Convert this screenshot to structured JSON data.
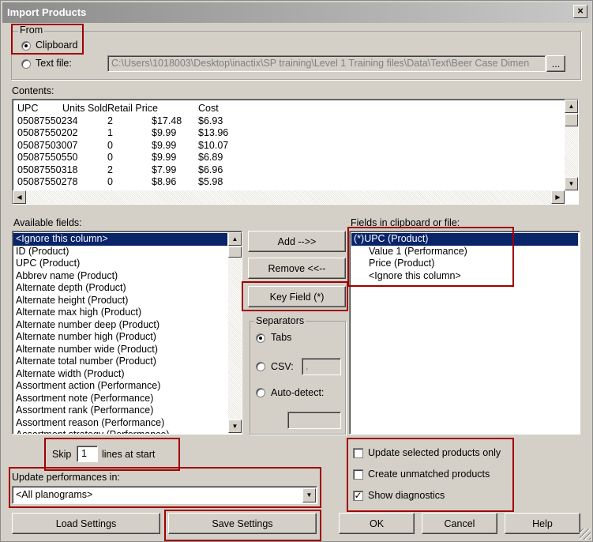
{
  "window": {
    "title": "Import Products",
    "close": "×"
  },
  "from": {
    "legend": "From",
    "clipboard_label": "Clipboard",
    "textfile_label": "Text file:",
    "textfile_path": "C:\\Users\\1018003\\Desktop\\inactix\\SP training\\Level 1 Training files\\Data\\Text\\Beer Case Dimen",
    "browse_label": "...",
    "selected": "clipboard"
  },
  "contents": {
    "label": "Contents:",
    "headers": [
      "UPC",
      "Units Sold",
      "Retail Price",
      "Cost"
    ],
    "rows": [
      [
        "05087550234",
        "2",
        "$17.48",
        "$6.93"
      ],
      [
        "05087550202",
        "1",
        "$9.99",
        "$13.96"
      ],
      [
        "05087503007",
        "0",
        "$9.99",
        "$10.07"
      ],
      [
        "05087550550",
        "0",
        "$9.99",
        "$6.89"
      ],
      [
        "05087550318",
        "2",
        "$7.99",
        "$6.96"
      ],
      [
        "05087550278",
        "0",
        "$8.96",
        "$5.98"
      ]
    ]
  },
  "available": {
    "label": "Available fields:",
    "items": [
      "<Ignore this column>",
      "ID (Product)",
      "UPC (Product)",
      "Abbrev name (Product)",
      "Alternate depth (Product)",
      "Alternate height (Product)",
      "Alternate max high (Product)",
      "Alternate number deep (Product)",
      "Alternate number high (Product)",
      "Alternate number wide (Product)",
      "Alternate total number (Product)",
      "Alternate width (Product)",
      "Assortment action (Performance)",
      "Assortment note (Performance)",
      "Assortment rank (Performance)",
      "Assortment reason (Performance)",
      "Assortment strategy (Performance)"
    ]
  },
  "buttons": {
    "add": "Add -->>",
    "remove": "Remove <<--",
    "key_field": "Key Field (*)",
    "load_settings": "Load Settings",
    "save_settings": "Save Settings",
    "ok": "OK",
    "cancel": "Cancel",
    "help": "Help"
  },
  "separators": {
    "legend": "Separators",
    "tabs": "Tabs",
    "csv": "CSV:",
    "csv_value": ",",
    "auto_detect": "Auto-detect:",
    "selected": "tabs"
  },
  "fields_in_file": {
    "label": "Fields in clipboard or file:",
    "items": [
      "(*)UPC (Product)",
      "Value 1 (Performance)",
      "Price (Product)",
      "<Ignore this column>"
    ]
  },
  "skip": {
    "prefix": "Skip",
    "value": "1",
    "suffix": "lines at start"
  },
  "update_performances": {
    "label": "Update performances in:",
    "value": "<All planograms>"
  },
  "options": {
    "update_selected": {
      "label": "Update selected products only",
      "checked": false
    },
    "create_unmatched": {
      "label": "Create unmatched products",
      "checked": false
    },
    "show_diagnostics": {
      "label": "Show diagnostics",
      "checked": true
    }
  },
  "colors": {
    "highlight": "#a00000",
    "selection": "#0a246a",
    "face": "#d4d0c8"
  }
}
